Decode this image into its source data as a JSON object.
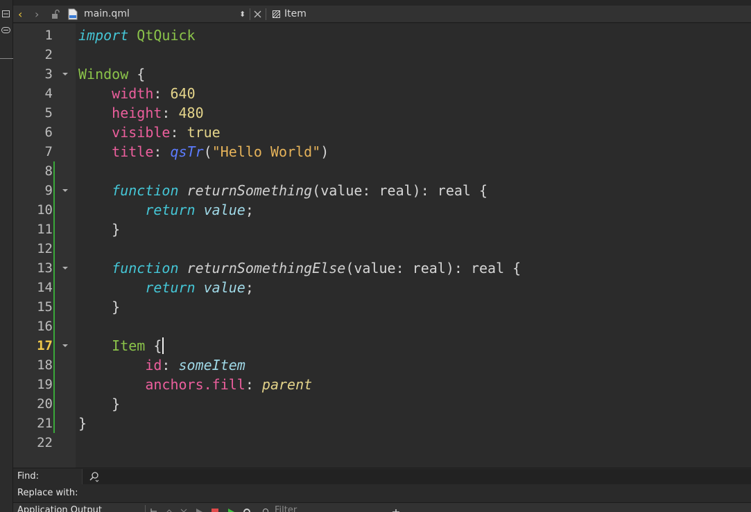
{
  "left_strip": {
    "icons": [
      "split-view-icon",
      "link-icon"
    ]
  },
  "toolbar": {
    "back_icon": "chevron-left-icon",
    "forward_icon": "chevron-right-icon",
    "lock_icon": "unlock-icon",
    "file_icon": "qml-file-icon",
    "filename": "main.qml",
    "close_icon": "close-icon",
    "symbol_icon": "symbol-icon",
    "current_symbol": "Item"
  },
  "editor": {
    "current_line": 17,
    "line_numbers": [
      "1",
      "2",
      "3",
      "4",
      "5",
      "6",
      "7",
      "8",
      "9",
      "10",
      "11",
      "12",
      "13",
      "14",
      "15",
      "16",
      "17",
      "18",
      "19",
      "20",
      "21",
      "22"
    ],
    "fold_lines": [
      3,
      9,
      13,
      17
    ],
    "tokens": {
      "import": "import",
      "qtquick": "QtQuick",
      "window": "Window",
      "brace_open": "{",
      "brace_close": "}",
      "width": "width",
      "height": "height",
      "visible": "visible",
      "title": "title",
      "colon": ":",
      "w640": "640",
      "h480": "480",
      "true_val": "true",
      "qstr": "qsTr",
      "lparen": "(",
      "rparen": ")",
      "hello": "\"Hello World\"",
      "function_kw": "function",
      "fn1": "returnSomething",
      "fn2": "returnSomethingElse",
      "params": "value: real): real",
      "return_kw": "return",
      "value": "value",
      "semicolon": ";",
      "item": "Item",
      "id": "id",
      "some_item": "someItem",
      "anchors_fill": "anchors.fill",
      "parent": "parent"
    },
    "colors": {
      "keyword": "#45c6d6",
      "type": "#8bc34a",
      "property": "#ec5f9d",
      "number": "#e4d48a",
      "string": "#e6b35a",
      "change_marker": "#3aa83a",
      "current_line_number": "#f0c94a"
    }
  },
  "find": {
    "find_label": "Find:",
    "search_icon": "search-icon",
    "replace_label": "Replace with:"
  },
  "output": {
    "title": "Application Output",
    "filter_placeholder": "Filter"
  }
}
